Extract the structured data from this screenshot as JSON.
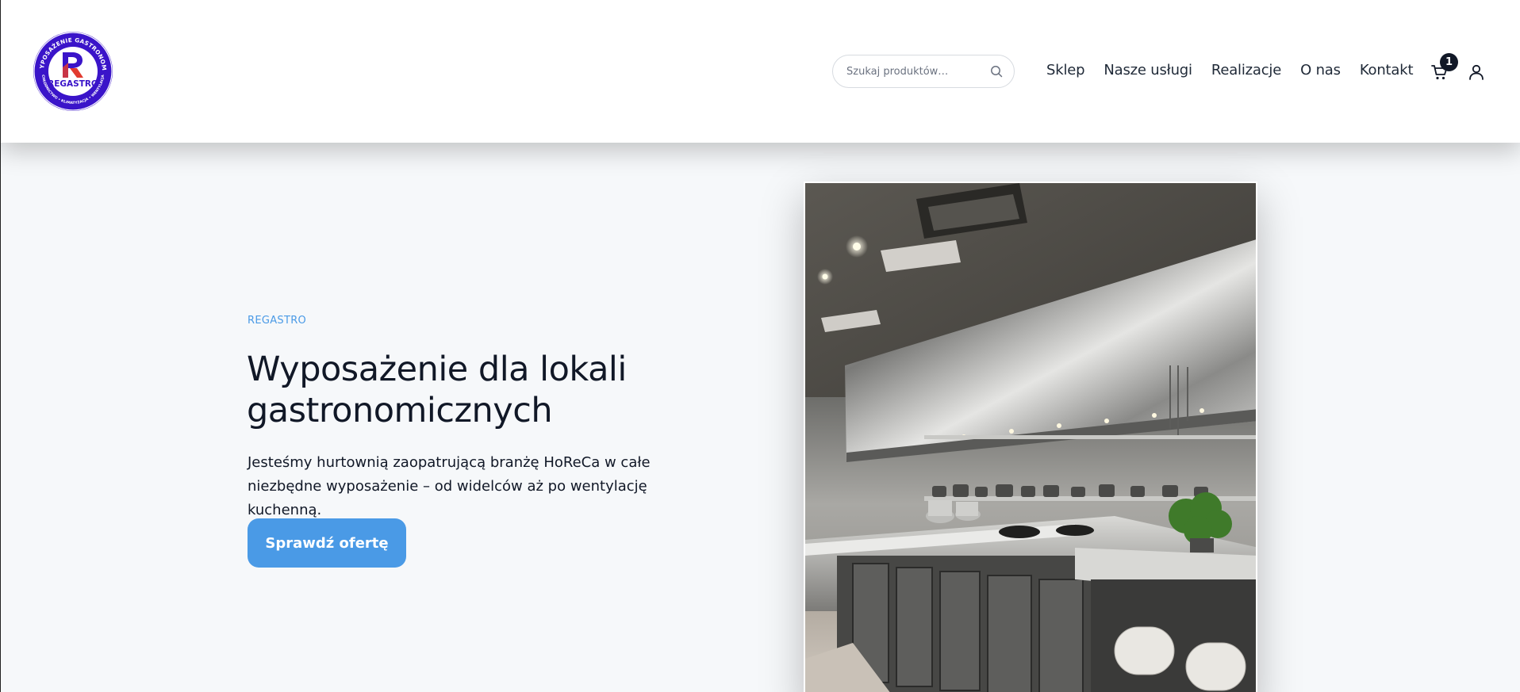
{
  "brand": {
    "logo_name": "REGASTRO",
    "logo_ring_text": "WYPOSAŻENIE GASTRONOMII",
    "logo_ring_text_bottom": "CHŁODNICTWO • KLIMATYZACJA • WENTYLACJA",
    "logo_color": "#3a14c9",
    "logo_accent": "#e23b2f"
  },
  "search": {
    "placeholder": "Szukaj produktów…",
    "value": "",
    "icon": "search-icon"
  },
  "nav": {
    "items": [
      {
        "label": "Sklep"
      },
      {
        "label": "Nasze usługi"
      },
      {
        "label": "Realizacje"
      },
      {
        "label": "O nas"
      },
      {
        "label": "Kontakt"
      }
    ]
  },
  "header_actions": {
    "cart_icon": "cart-icon",
    "cart_count": "1",
    "user_icon": "user-icon"
  },
  "hero": {
    "eyebrow": "REGASTRO",
    "title": "Wyposażenie dla lokali gastronomicznych",
    "description": "Jesteśmy hurtownią zaopatrującą branżę HoReCa w całe niezbędne wyposażenie – od widelców aż po wentylację kuchenną.",
    "cta_label": "Sprawdź ofertę",
    "image_subject": "commercial stainless steel kitchen"
  },
  "colors": {
    "accent": "#4a9ae6",
    "text": "#111827",
    "background": "#f6f8fa"
  }
}
